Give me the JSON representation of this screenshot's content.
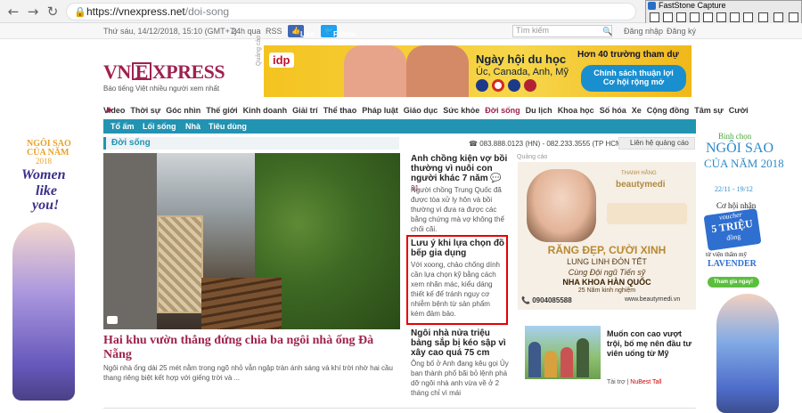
{
  "browser": {
    "url_domain": "https://vnexpress.net",
    "url_path": "/doi-song"
  },
  "capture_tool": {
    "title": "FastStone Capture"
  },
  "topbar": {
    "date": "Thứ sáu, 14/12/2018, 15:10 (GMT+7)",
    "link_24h": "24h qua",
    "link_rss": "RSS",
    "like_label": "Like",
    "follow_label": "Follow",
    "search_placeholder": "Tìm kiếm",
    "login": "Đăng nhập",
    "register": "Đăng ký"
  },
  "logo": {
    "text_left": "VN",
    "text_box": "E",
    "text_right": "XPRESS",
    "tagline": "Báo tiếng Việt nhiều người xem nhất"
  },
  "banner": {
    "ad_label": "Quảng cáo",
    "brand": "idp",
    "headline": "Ngày hội du học",
    "countries": "Úc, Canada, Anh, Mỹ",
    "right_title": "Hơn 40 trường tham dự",
    "cta_line1": "Chính sách thuận lợi",
    "cta_line2": "Cơ hội rộng mở"
  },
  "nav": {
    "items": [
      "Video",
      "Thời sự",
      "Góc nhìn",
      "Thế giới",
      "Kinh doanh",
      "Giải trí",
      "Thể thao",
      "Pháp luật",
      "Giáo dục",
      "Sức khỏe",
      "Đời sống",
      "Du lịch",
      "Khoa học",
      "Số hóa",
      "Xe",
      "Cộng đồng",
      "Tâm sự",
      "Cười"
    ],
    "active_index": 10
  },
  "subnav": {
    "items": [
      "Tổ ấm",
      "Lối sống",
      "Nhà",
      "Tiêu dùng"
    ]
  },
  "section": {
    "title": "Đời sống",
    "contact": "083.888.0123 (HN) - 082.233.3555 (TP HCM)",
    "ad_contact": "Liên hệ quảng cáo"
  },
  "main_article": {
    "title": "Hai khu vườn thẳng đứng chia ba ngôi nhà ống Đà Nẵng",
    "lead": "Ngôi nhà ống dài 25 mét nằm trong ngõ nhỏ vẫn ngập tràn ánh sáng và khí trời nhờ hai cầu thang riêng biệt kết hợp với giếng trời và ..."
  },
  "middle_articles": [
    {
      "title": "Anh chồng kiện vợ bồi thường vì nuôi con người khác 7 năm",
      "comments": "31",
      "summary": "Người chồng Trung Quốc đã được tòa xử ly hôn và bồi thường vì đưa ra được các bằng chứng mà vợ không thể chối cãi."
    },
    {
      "title": "Lưu ý khi lựa chọn đồ bếp gia dụng",
      "summary": "Với xoong, chảo chống dính cần lựa chọn kỹ bằng cách xem nhãn mác, kiểu dáng thiết kế để tránh nguy cơ nhiễm bệnh từ sản phẩm kém đảm bảo."
    },
    {
      "title": "Ngôi nhà nửa triệu bảng sắp bị kéo sập vì xây cao quá 75 cm",
      "summary": "Ông bố ở Anh đang kêu gọi Ủy ban thành phố bãi bỏ lệnh phá dỡ ngôi nhà anh vừa về ở 2 tháng chỉ vì mái"
    }
  ],
  "right_ad": {
    "ad_label": "Quảng cáo",
    "brand_small": "THANH HẰNG",
    "brand": "beautymedi",
    "headline": "RĂNG ĐẸP, CƯỜI XINH",
    "subline": "LUNG LINH ĐÓN TẾT",
    "team": "Cùng Đội ngũ Tiến sỹ",
    "clinic": "NHA KHOA HÀN QUỐC",
    "experience": "25 Năm kinh nghiệm",
    "phone": "0904085588",
    "website": "www.beautymedi.vn"
  },
  "promo": {
    "title": "Muốn con cao vượt trội, bố mẹ nên đầu tư viên uống từ Mỹ",
    "sponsor_prefix": "Tài trợ |",
    "sponsor": "NuBest Tall"
  },
  "left_ad": {
    "line1": "NGÔI SAO",
    "line2": "CỦA NĂM",
    "year": "2018",
    "line3": "Women",
    "line4": "like",
    "line5": "you!"
  },
  "right_side_ad": {
    "line1": "Bình chọn",
    "line2": "NGÔI SAO",
    "line3": "CỦA NĂM 2018",
    "dates": "22/11 - 19/12",
    "line4": "Cơ hội nhận",
    "voucher": "voucher",
    "amount": "5 TRIỆU",
    "unit": "đồng",
    "line5": "từ viện thẩm mỹ",
    "brand": "LAVENDER",
    "cta": "Tham gia ngay!"
  }
}
